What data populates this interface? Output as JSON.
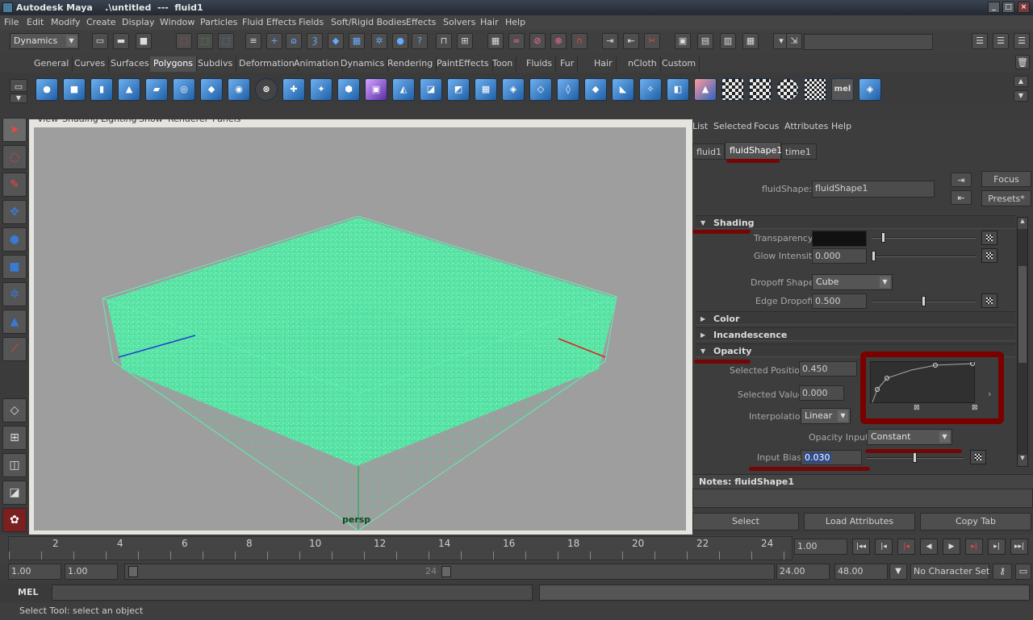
{
  "window": {
    "title": "Autodesk Maya",
    "doc": ".\\untitled  ---  fluid1",
    "min": "_",
    "max": "□",
    "close": "×"
  },
  "menubar": [
    "File",
    "Edit",
    "Modify",
    "Create",
    "Display",
    "Window",
    "Particles",
    "Fluid Effects",
    "Fields",
    "Soft/Rigid Bodies",
    "Effects",
    "Solvers",
    "Hair",
    "Help"
  ],
  "status": {
    "menuset": "Dynamics",
    "input_field": ""
  },
  "shelf_tabs": [
    "General",
    "Curves",
    "Surfaces",
    "Polygons",
    "Subdivs",
    "Deformation",
    "Animation",
    "Dynamics",
    "Rendering",
    "PaintEffects",
    "Toon",
    "Fluids",
    "Fur",
    "Hair",
    "nCloth",
    "Custom"
  ],
  "shelf_active": "Polygons",
  "shelf_mel": "mel",
  "viewport": {
    "menu": [
      "View",
      "Shading",
      "Lighting",
      "Show",
      "Renderer",
      "Panels"
    ],
    "camera": "persp"
  },
  "attr_editor": {
    "menu": [
      "List",
      "Selected",
      "Focus",
      "Attributes",
      "Help"
    ],
    "tabs": [
      "fluid1",
      "fluidShape1",
      "time1"
    ],
    "active_tab": "fluidShape1",
    "node_label": "fluidShape:",
    "node_name": "fluidShape1",
    "focus_label": "Focus",
    "presets_label": "Presets*",
    "sections": {
      "shading": "Shading",
      "color": "Color",
      "incandescence": "Incandescence",
      "opacity": "Opacity"
    },
    "transparency_label": "Transparency",
    "glow_label": "Glow Intensity",
    "glow_value": "0.000",
    "glow_level": 0.0,
    "dropoff_shape_label": "Dropoff Shape",
    "dropoff_shape_value": "Cube",
    "edge_dropoff_label": "Edge Dropoff",
    "edge_dropoff_value": "0.500",
    "edge_dropoff_level": 0.5,
    "selected_position_label": "Selected Position",
    "selected_position_value": "0.450",
    "selected_value_label": "Selected Value",
    "selected_value_value": "0.000",
    "interpolation_label": "Interpolation",
    "interpolation_value": "Linear",
    "opacity_input_label": "Opacity Input",
    "opacity_input_value": "Constant",
    "input_bias_label": "Input Bias",
    "input_bias_value": "0.030",
    "input_bias_level": 0.5,
    "notes_label": "Notes:  fluidShape1",
    "bottom_buttons": [
      "Select",
      "Load Attributes",
      "Copy Tab"
    ]
  },
  "timeline": {
    "ticks": [
      "2",
      "4",
      "6",
      "8",
      "10",
      "12",
      "14",
      "16",
      "18",
      "20",
      "22",
      "24"
    ],
    "current_frame": "1.00"
  },
  "range": {
    "start": "1.00",
    "anim_start": "1.00",
    "range_end_label": "24",
    "playback_end": "24.00",
    "anim_end": "48.00",
    "character_set": "No Character Set"
  },
  "mel": {
    "label": "MEL"
  },
  "help_line": "Select Tool: select an object"
}
